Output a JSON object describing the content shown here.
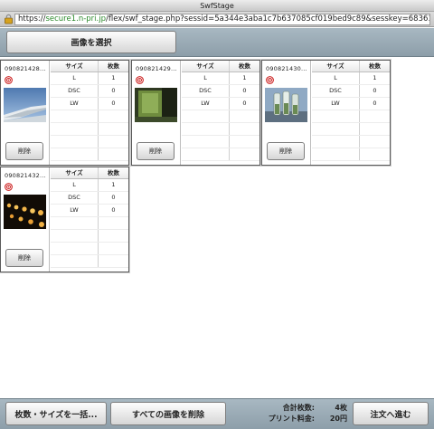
{
  "window": {
    "title": "SwfStage"
  },
  "browser": {
    "url_scheme": "https://",
    "url_host": "secure1.n-pri.jp",
    "url_path": "/flex/swf_stage.php?sessid=5a344e3aba1c7b637085cf019bed9c89&sesskey=68361..."
  },
  "toolbar": {
    "select_images_label": "画像を選択"
  },
  "table_headers": {
    "size": "サイズ",
    "count": "枚数"
  },
  "cards": [
    {
      "filename": "090821428...",
      "delete_label": "削除",
      "thumb": "airplane-wing",
      "rows": [
        {
          "size": "L",
          "count": "1"
        },
        {
          "size": "DSC",
          "count": "0"
        },
        {
          "size": "LW",
          "count": "0"
        }
      ]
    },
    {
      "filename": "090821429...",
      "delete_label": "削除",
      "thumb": "green-window",
      "rows": [
        {
          "size": "L",
          "count": "1"
        },
        {
          "size": "DSC",
          "count": "0"
        },
        {
          "size": "LW",
          "count": "0"
        }
      ]
    },
    {
      "filename": "090821430...",
      "delete_label": "削除",
      "thumb": "glass-bottles",
      "rows": [
        {
          "size": "L",
          "count": "1"
        },
        {
          "size": "DSC",
          "count": "0"
        },
        {
          "size": "LW",
          "count": "0"
        }
      ]
    },
    {
      "filename": "090821432...",
      "delete_label": "削除",
      "thumb": "night-lights",
      "rows": [
        {
          "size": "L",
          "count": "1"
        },
        {
          "size": "DSC",
          "count": "0"
        },
        {
          "size": "LW",
          "count": "0"
        }
      ]
    }
  ],
  "footer": {
    "bulk_label": "枚数・サイズを一括...",
    "delete_all_label": "すべての画像を削除",
    "total_count_label": "合計枚数:",
    "total_count_value": "4枚",
    "print_fee_label": "プリント料金:",
    "print_fee_value": "20円",
    "order_label": "注文へ進む"
  },
  "colors": {
    "toolbar": "#9aabb5",
    "url_host": "#2c8a2c",
    "target_icon": "#cc1f1f"
  }
}
